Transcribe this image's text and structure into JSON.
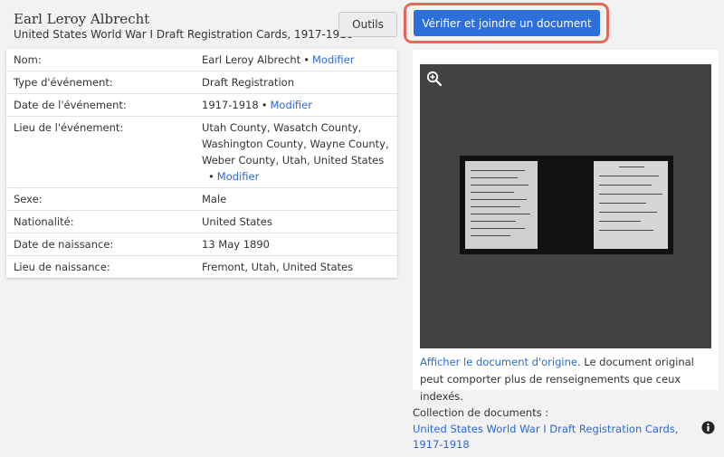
{
  "header": {
    "name": "Earl Leroy Albrecht",
    "collection": "United States World War I Draft Registration Cards, 1917-1918",
    "tools_label": "Outils",
    "attach_label": "Vérifier et joindre un document"
  },
  "facts": [
    {
      "label": "Nom:",
      "value": "Earl Leroy Albrecht",
      "dot": "•",
      "link": "Modifier"
    },
    {
      "label": "Type d'événement:",
      "value": "Draft Registration"
    },
    {
      "label": "Date de l'événement:",
      "value": "1917-1918",
      "dot": "•",
      "link": "Modifier"
    },
    {
      "label": "Lieu de l'événement:",
      "value_lines": [
        "Utah County, Wasatch County,",
        "Washington County, Wayne County,",
        "Weber County, Utah, United States"
      ],
      "dot": "•",
      "link": "Modifier"
    },
    {
      "label": "Sexe:",
      "value": "Male"
    },
    {
      "label": "Nationalité:",
      "value": "United States"
    },
    {
      "label": "Date de naissance:",
      "value": "13 May 1890"
    },
    {
      "label": "Lieu de naissance:",
      "value": "Fremont, Utah, United States"
    }
  ],
  "viewer": {
    "zoom_icon": "zoom-in-icon",
    "original_link": "Afficher le document d'origine",
    "caption_rest": ". Le document original peut comporter plus de renseignements que ceux indexés."
  },
  "collection_box": {
    "label": "Collection de documents :",
    "link": "United States World War I Draft Registration Cards, 1917-1918",
    "info_icon": "info-icon"
  },
  "colors": {
    "primary": "#2d6fdb",
    "highlight": "#e2695a",
    "link": "#2a6ad1",
    "viewer_bg": "#424242"
  }
}
